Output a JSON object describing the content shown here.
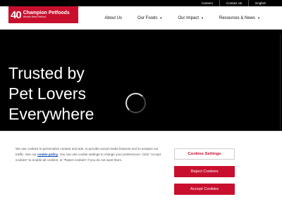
{
  "utility_bar": {
    "links": [
      "Careers",
      "Contact Us",
      "English"
    ]
  },
  "logo": {
    "number": "40",
    "name": "Champion Petfoods",
    "tagline": "World's Best Petfood"
  },
  "nav": {
    "items": [
      {
        "label": "About Us",
        "has_dropdown": false
      },
      {
        "label": "Our Foods",
        "has_dropdown": true
      },
      {
        "label": "Our Impact",
        "has_dropdown": true
      },
      {
        "label": "Resources & News",
        "has_dropdown": true
      }
    ],
    "caret": "▼"
  },
  "hero": {
    "title_lines": [
      "Trusted by",
      "Pet Lovers",
      "Everywhere"
    ]
  },
  "cookie": {
    "text_before": "We use cookies to personalize content and ads, to provide social media features and to analyze our traffic. See our ",
    "policy_link": "cookie policy",
    "text_after": ". You can use cookie settings to change your preferences. Click \"Accept cookies\" to enable all cookies, or \"Reject cookies\" if you do not want them.",
    "settings_label": "Cookies Settings",
    "reject_label": "Reject Cookies",
    "accept_label": "Accept Cookies"
  },
  "colors": {
    "brand_red": "#c8102e",
    "background": "#000000"
  }
}
